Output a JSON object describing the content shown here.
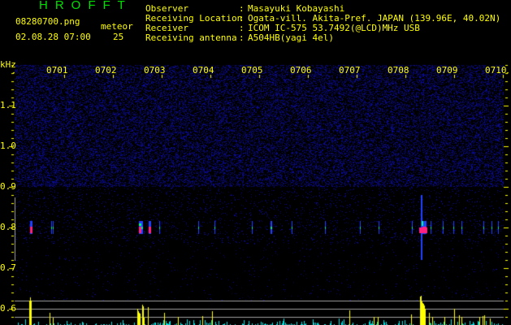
{
  "header": {
    "app_title": "HROFFT",
    "filename": "08280700.png",
    "datetime": "02.08.28 07:00",
    "meteor_label": "meteor",
    "meteor_count": "25",
    "info": [
      {
        "label": "Observer",
        "value": "Masayuki Kobayashi"
      },
      {
        "label": "Receiving Location",
        "value": "Ogata-vill. Akita-Pref. JAPAN (139.96E, 40.02N)"
      },
      {
        "label": "Receiver",
        "value": "ICOM IC-575 53.7492(@LCD)MHz USB"
      },
      {
        "label": "Receiving antenna",
        "value": "A504HB(yagi 4el)"
      }
    ]
  },
  "spectrogram": {
    "y_unit": "kHz",
    "y_ticks": [
      "1.1",
      "1.0",
      "0.9",
      "0.8",
      "0.7",
      "0.6"
    ],
    "time_ticks": [
      "0701",
      "0702",
      "0703",
      "0704",
      "0705",
      "0706",
      "0707",
      "0708",
      "0709",
      "0710"
    ],
    "colors": {
      "text": "#ffff00",
      "title": "#00e000",
      "noise": "#1010a0",
      "echo": "#ff2080",
      "bar_strong": "#ffff00",
      "bar_weak": "#00e0e0",
      "guide": "#a0a0a0"
    }
  }
}
